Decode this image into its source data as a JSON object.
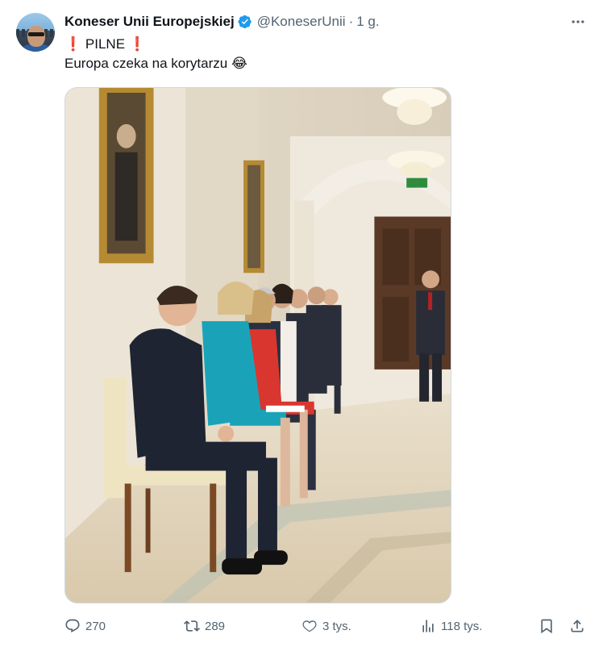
{
  "tweet": {
    "display_name": "Koneser Unii Europejskiej",
    "handle": "@KoneserUnii",
    "separator": "·",
    "time": "1 g.",
    "verified": true,
    "text_line1": "PILNE",
    "text_line2": "Europa czeka na korytarzu",
    "emoji": "😂",
    "exclamation": "❗"
  },
  "actions": {
    "replies": "270",
    "reposts": "289",
    "likes": "3 tys.",
    "views": "118 tys."
  },
  "icons": {
    "verified": "verified-badge-icon",
    "more": "more-dots-icon",
    "reply": "reply-icon",
    "repost": "repost-icon",
    "like": "heart-icon",
    "views": "views-icon",
    "bookmark": "bookmark-icon",
    "share": "share-icon"
  },
  "colors": {
    "text": "#0f1419",
    "muted": "#536471",
    "verified": "#1d9bf0",
    "exclamation": "#d92b2b"
  }
}
